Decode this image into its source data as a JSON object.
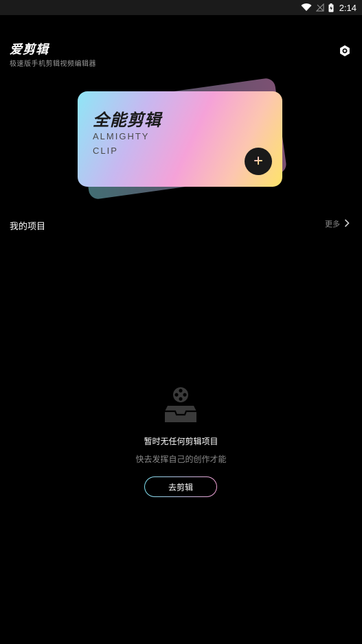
{
  "status_bar": {
    "time": "2:14",
    "icons": [
      "wifi-icon",
      "no-signal-icon",
      "battery-charging-icon"
    ]
  },
  "header": {
    "title": "爱剪辑",
    "subtitle": "极速版手机剪辑视频编辑器",
    "settings_icon": "gear-icon"
  },
  "banner": {
    "title": "全能剪辑",
    "en_line1": "ALMIGHTY",
    "en_line2": "CLIP",
    "add_icon": "plus-icon"
  },
  "projects": {
    "title": "我的项目",
    "more_label": "更多"
  },
  "empty_state": {
    "icon": "film-reel-inbox-icon",
    "title": "暂时无任何剪辑项目",
    "description": "快去发挥自己的创作才能",
    "button_label": "去剪辑"
  },
  "colors": {
    "background": "#000000",
    "accent_start": "#7fe3f3",
    "accent_end": "#f3a0d6",
    "banner_yellow": "#fde36a"
  }
}
